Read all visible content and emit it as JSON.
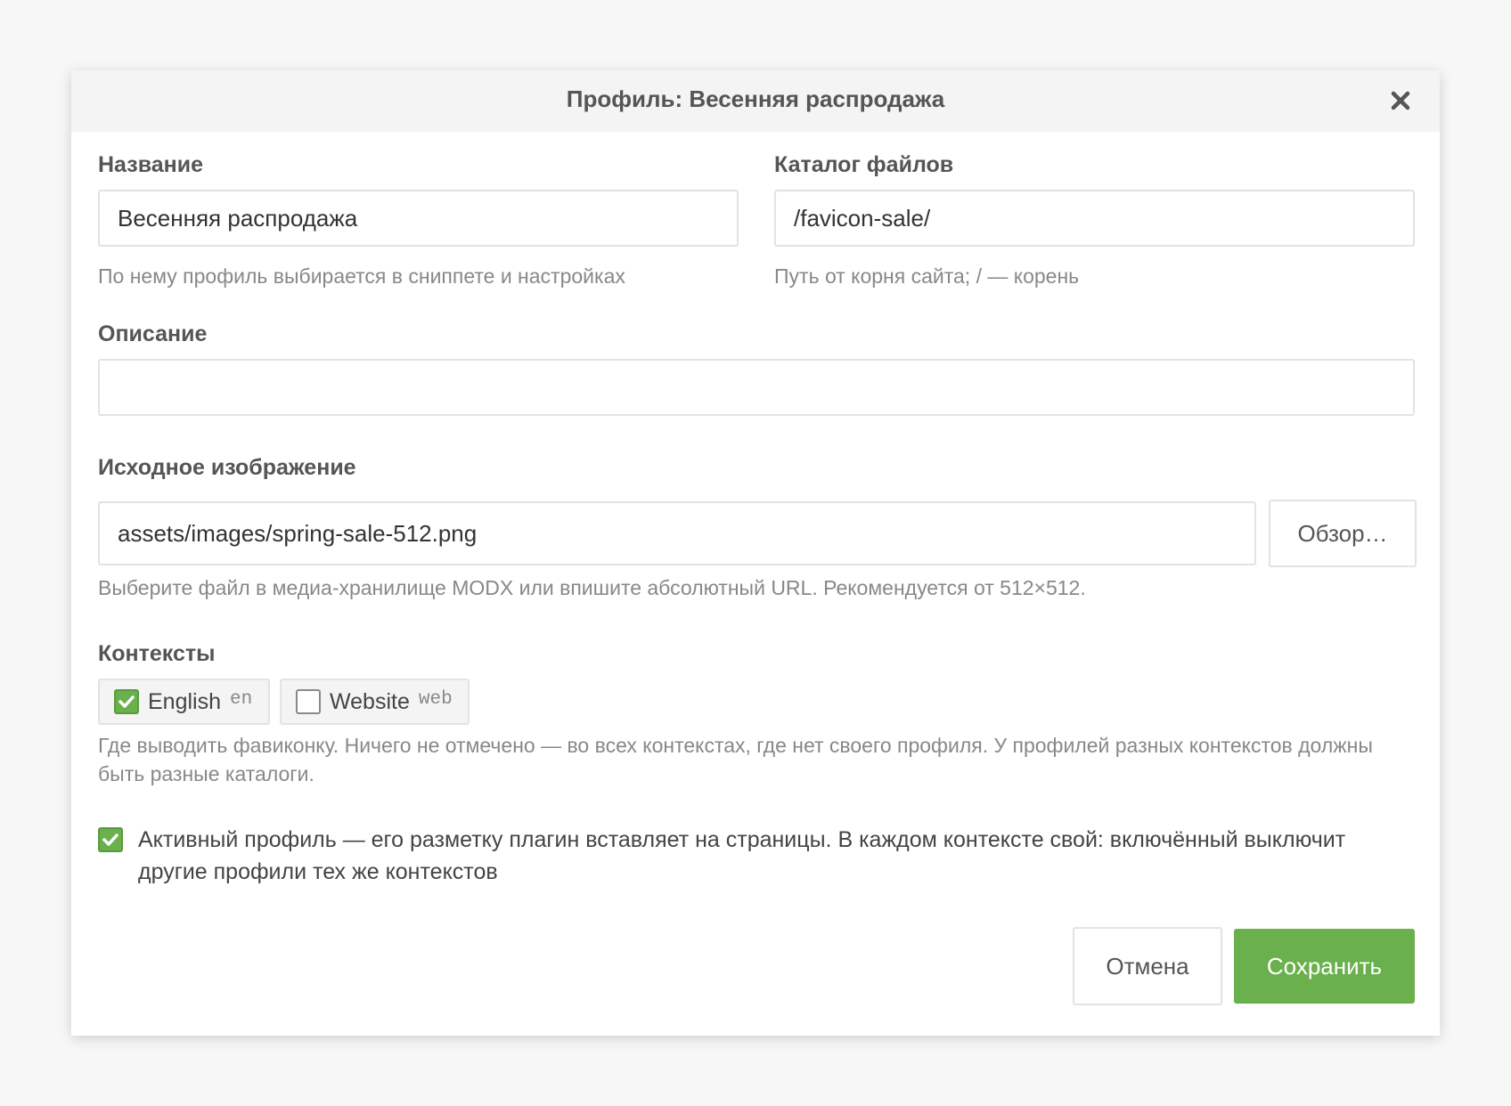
{
  "dialog": {
    "title": "Профиль: Весенняя распродажа"
  },
  "form": {
    "name": {
      "label": "Название",
      "value": "Весенняя распродажа",
      "hint": "По нему профиль выбирается в сниппете и настройках"
    },
    "catalog": {
      "label": "Каталог файлов",
      "value": "/favicon-sale/",
      "hint": "Путь от корня сайта; / — корень"
    },
    "description": {
      "label": "Описание",
      "value": ""
    },
    "source_image": {
      "label": "Исходное изображение",
      "value": "assets/images/spring-sale-512.png",
      "browse_label": "Обзор…",
      "hint": "Выберите файл в медиа-хранилище MODX или впишите абсолютный URL. Рекомендуется от 512×512."
    },
    "contexts": {
      "label": "Контексты",
      "items": [
        {
          "name": "English",
          "key": "en",
          "checked": true
        },
        {
          "name": "Website",
          "key": "web",
          "checked": false
        }
      ],
      "hint": "Где выводить фавиконку. Ничего не отмечено — во всех контекстах, где нет своего профиля. У профилей разных контекстов должны быть разные каталоги."
    },
    "active": {
      "checked": true,
      "label": "Активный профиль — его разметку плагин вставляет на страницы. В каждом контексте свой: включённый выключит другие профили тех же контекстов"
    }
  },
  "footer": {
    "cancel_label": "Отмена",
    "save_label": "Сохранить"
  },
  "colors": {
    "accent": "#6ab04c",
    "background": "#f7f7f7",
    "header": "#f4f4f4"
  },
  "icons": {
    "close": "close-icon",
    "check": "check-icon"
  }
}
